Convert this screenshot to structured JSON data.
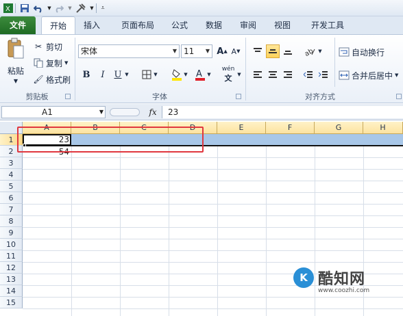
{
  "qat": {
    "save_icon": "save-icon",
    "undo_icon": "undo-icon",
    "redo_icon": "redo-icon",
    "tool_icon": "tools-icon"
  },
  "tabs": [
    "文件",
    "开始",
    "插入",
    "页面布局",
    "公式",
    "数据",
    "审阅",
    "视图",
    "开发工具"
  ],
  "active_tab": "开始",
  "clipboard": {
    "paste": "粘贴",
    "cut": "剪切",
    "copy": "复制",
    "format_painter": "格式刷",
    "label": "剪贴板"
  },
  "font": {
    "name": "宋体",
    "size": "11",
    "bold": "B",
    "italic": "I",
    "underline": "U",
    "label": "字体",
    "wen": "wén"
  },
  "alignment": {
    "wrap_text": "自动换行",
    "merge_center": "合并后居中",
    "label": "对齐方式"
  },
  "formula_bar": {
    "name_box": "A1",
    "fx": "fx",
    "value": "23"
  },
  "grid": {
    "columns": [
      "A",
      "B",
      "C",
      "D",
      "E",
      "F",
      "G",
      "H"
    ],
    "rows": [
      "1",
      "2",
      "3",
      "4",
      "5",
      "6",
      "7",
      "8",
      "9",
      "10",
      "11",
      "12",
      "13",
      "14",
      "15"
    ],
    "cells": {
      "A1": "23",
      "A2": "54"
    }
  },
  "watermark": {
    "logo": "K",
    "title": "酷知网",
    "url": "www.coozhi.com"
  },
  "colors": {
    "file_tab": "#2a7b2f",
    "highlight": "#e0363e",
    "selection": "#a8c7e8"
  }
}
